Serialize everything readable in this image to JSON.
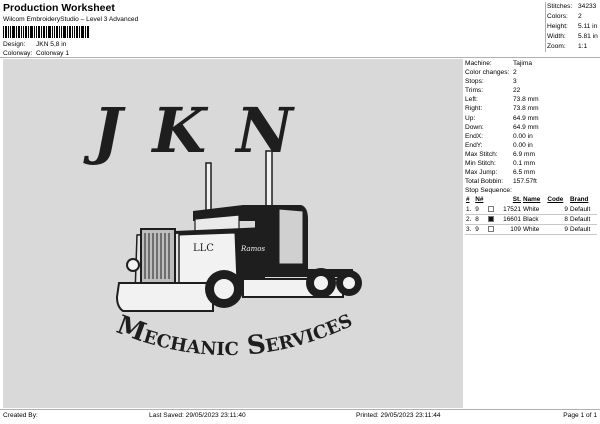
{
  "header": {
    "title": "Production Worksheet",
    "subtitle": "Wilcom EmbroideryStudio – Level 3 Advanced",
    "design_label": "Design:",
    "design_value": "JKN 5,8 in",
    "colorway_label": "Colorway:",
    "colorway_value": "Colorway 1"
  },
  "stats": [
    {
      "label": "Stitches:",
      "value": "34233"
    },
    {
      "label": "Colors:",
      "value": "2"
    },
    {
      "label": "Height:",
      "value": "5.11 in"
    },
    {
      "label": "Width:",
      "value": "5.81 in"
    },
    {
      "label": "Zoom:",
      "value": "1:1"
    }
  ],
  "artwork": {
    "top_text": "JKN",
    "bottom_text": "Mechanic Services",
    "door_text": "LLC",
    "script_text": "Ramos",
    "colors": {
      "black": "#1e1e1e",
      "white": "#f2f2f2",
      "background": "#d9d9d9"
    }
  },
  "machine_info": [
    {
      "label": "Machine:",
      "value": "Tajima"
    },
    {
      "label": "Color changes:",
      "value": "2"
    },
    {
      "label": "Stops:",
      "value": "3"
    },
    {
      "label": "Trims:",
      "value": "22"
    },
    {
      "label": "Left:",
      "value": "73.8 mm"
    },
    {
      "label": "Right:",
      "value": "73.8 mm"
    },
    {
      "label": "Up:",
      "value": "64.9 mm"
    },
    {
      "label": "Down:",
      "value": "64.9 mm"
    },
    {
      "label": "EndX:",
      "value": "0.00 in"
    },
    {
      "label": "EndY:",
      "value": "0.00 in"
    },
    {
      "label": "Max Stitch:",
      "value": "6.9 mm"
    },
    {
      "label": "Min Stitch:",
      "value": "0.1 mm"
    },
    {
      "label": "Max Jump:",
      "value": "6.5 mm"
    },
    {
      "label": "Total Bobbin:",
      "value": "157.57ft"
    }
  ],
  "stop_sequence": {
    "title": "Stop Sequence:",
    "headers": [
      "#",
      "N#",
      "",
      "St.",
      "Name",
      "Code",
      "Brand"
    ],
    "rows": [
      {
        "num": "1.",
        "n": "9",
        "color": "#ffffff",
        "st": "17521",
        "name": "White",
        "code": "9",
        "brand": "Default"
      },
      {
        "num": "2.",
        "n": "8",
        "color": "#111111",
        "st": "16601",
        "name": "Black",
        "code": "8",
        "brand": "Default"
      },
      {
        "num": "3.",
        "n": "9",
        "color": "#ffffff",
        "st": "109",
        "name": "White",
        "code": "9",
        "brand": "Default"
      }
    ]
  },
  "footer": {
    "created_by": "Created By:",
    "last_saved": "Last Saved: 29/05/2023 23:11:40",
    "printed": "Printed: 29/05/2023 23:11:44",
    "page": "Page 1 of 1"
  }
}
